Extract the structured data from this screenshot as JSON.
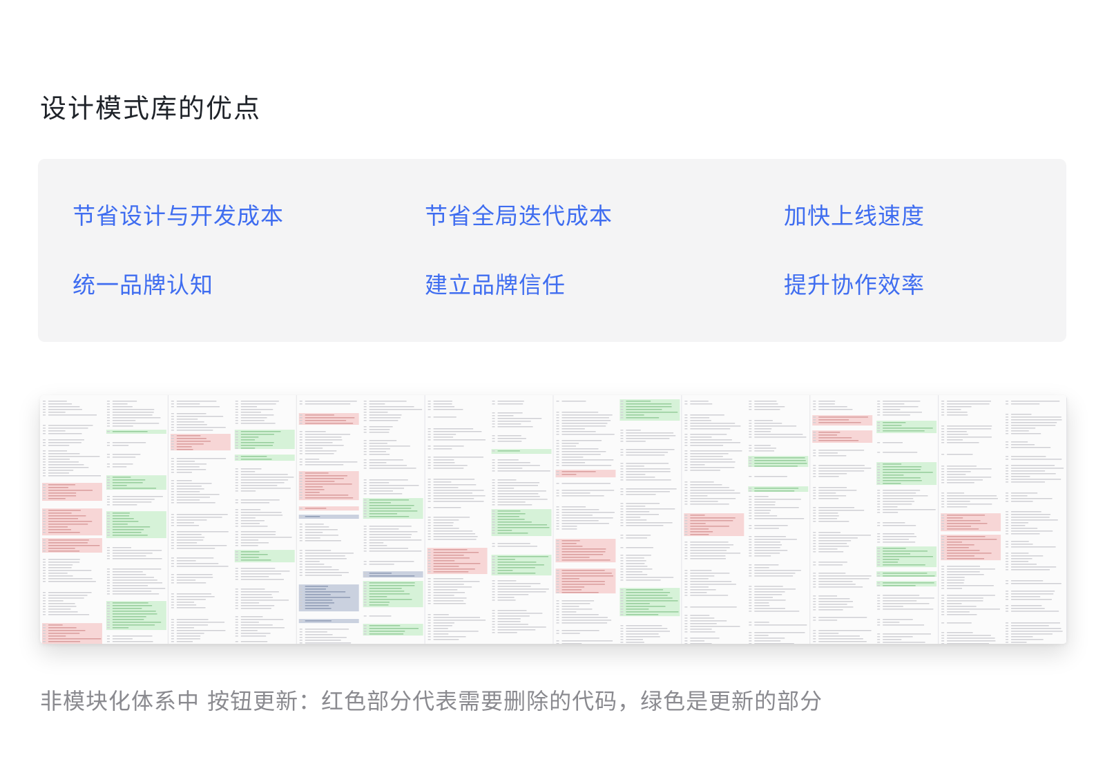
{
  "title": "设计模式库的优点",
  "benefits": [
    "节省设计与开发成本",
    "节省全局迭代成本",
    "加快上线速度",
    "统一品牌认知",
    "建立品牌信任",
    "提升协作效率"
  ],
  "figure": {
    "kind": "code-diff-screenshot",
    "diff_colors": {
      "removed": "#f6c9c9",
      "added": "#c9efcc",
      "neutral": "#e9e9ee",
      "highlight": "#b9c3d6"
    }
  },
  "caption": "非模块化体系中 按钮更新：红色部分代表需要删除的代码，绿色是更新的部分",
  "colors": {
    "title": "#1f2329",
    "accent": "#3f6df0",
    "card_bg": "#f4f4f5",
    "caption": "#8a8a8f"
  }
}
